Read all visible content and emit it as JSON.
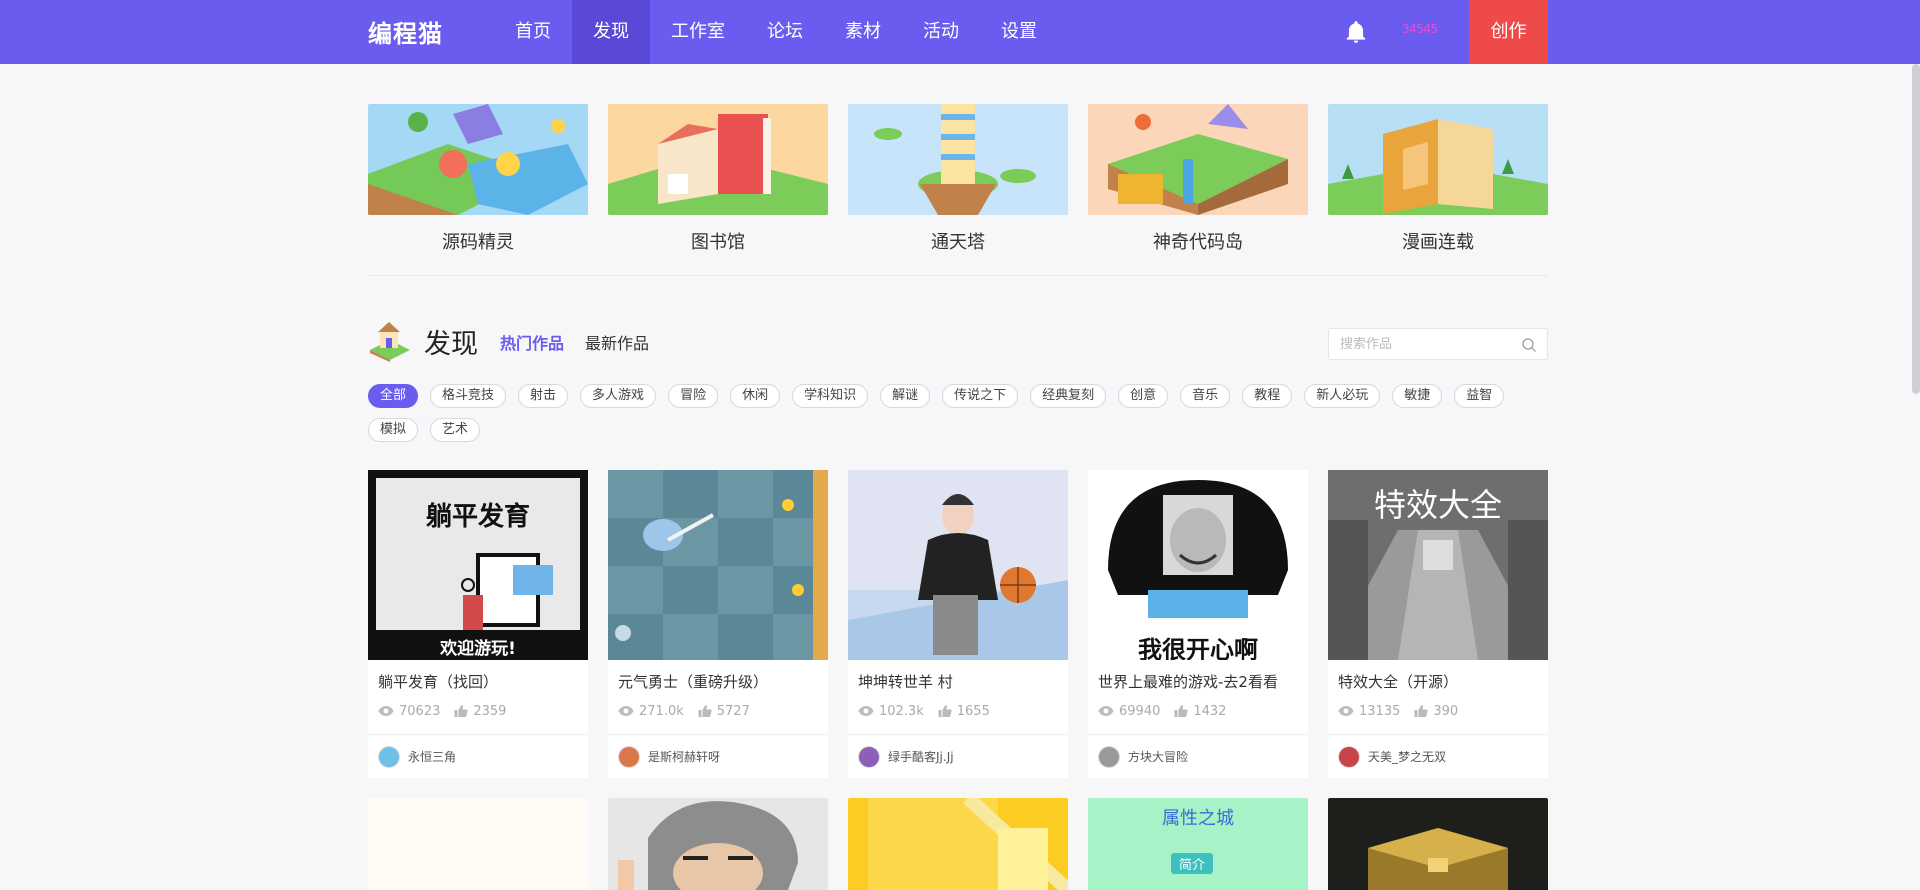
{
  "header": {
    "logo": "编程猫",
    "nav": [
      "首页",
      "发现",
      "工作室",
      "论坛",
      "素材",
      "活动",
      "设置"
    ],
    "active_nav": "发现",
    "username": "34545",
    "create_label": "创作",
    "colors": {
      "bar": "#6b5cf0",
      "active": "#5a48d6",
      "create": "#ee4a4a"
    }
  },
  "features": [
    {
      "label": "源码精灵",
      "bg": "#a5d8f5"
    },
    {
      "label": "图书馆",
      "bg": "#fcd8a0"
    },
    {
      "label": "通天塔",
      "bg": "#c7e4fb"
    },
    {
      "label": "神奇代码岛",
      "bg": "#fbd6b8"
    },
    {
      "label": "漫画连载",
      "bg": "#b7e0f7"
    }
  ],
  "discover": {
    "title": "发现",
    "tab_hot": "热门作品",
    "tab_new": "最新作品",
    "search_placeholder": "搜索作品"
  },
  "tags": [
    "全部",
    "格斗竞技",
    "射击",
    "多人游戏",
    "冒险",
    "休闲",
    "学科知识",
    "解谜",
    "传说之下",
    "经典复刻",
    "创意",
    "音乐",
    "教程",
    "新人必玩",
    "敏捷",
    "益智",
    "模拟",
    "艺术"
  ],
  "cards": [
    {
      "title": "躺平发育（找回）",
      "views": "70623",
      "likes": "2359",
      "author": "永恒三角",
      "overlay_top": "躺平发育",
      "overlay_bottom": "欢迎游玩!"
    },
    {
      "title": "元气勇士（重磅升级）",
      "views": "271.0k",
      "likes": "5727",
      "author": "是斯柯赫轩呀"
    },
    {
      "title": "坤坤转世羊 村",
      "views": "102.3k",
      "likes": "1655",
      "author": "绿手酷客Jj.Jj"
    },
    {
      "title": "世界上最难的游戏-去2看看",
      "views": "69940",
      "likes": "1432",
      "author": "方块大冒险",
      "overlay_bottom": "我很开心啊"
    },
    {
      "title": "特效大全（开源）",
      "views": "13135",
      "likes": "390",
      "author": "天美_梦之无双",
      "overlay_top": "特效大全"
    }
  ],
  "cards_row2": [
    {
      "text": ""
    },
    {
      "text": ""
    },
    {
      "text": ""
    },
    {
      "text": "属性之城",
      "button": "简介"
    },
    {
      "text": ""
    }
  ]
}
